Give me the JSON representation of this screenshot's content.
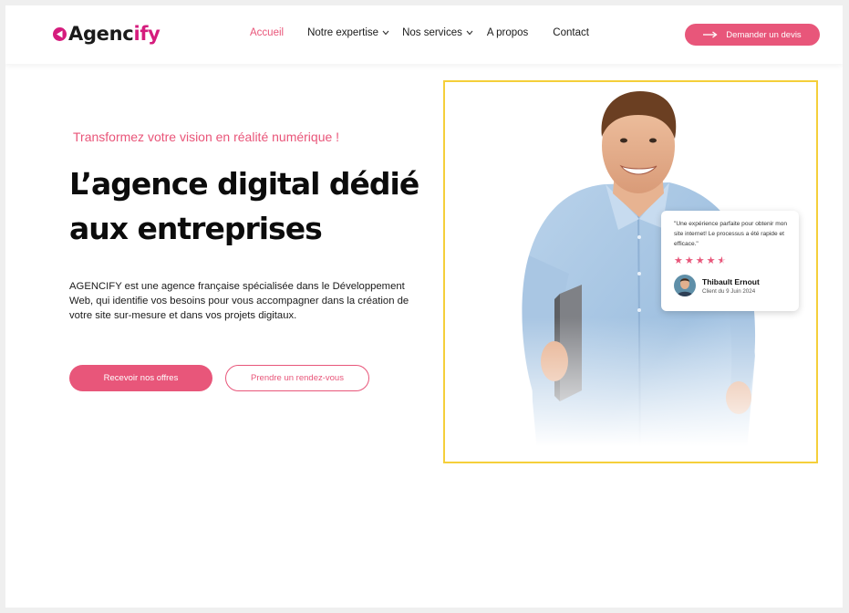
{
  "header": {
    "logo": {
      "prefix": "Ag",
      "mid": "ən",
      "main": "c",
      "accent": "ify",
      "full": "Agencify"
    },
    "nav": [
      {
        "label": "Accueil",
        "active": true,
        "has_dropdown": false
      },
      {
        "label": "Notre expertise",
        "active": false,
        "has_dropdown": true
      },
      {
        "label": "Nos services",
        "active": false,
        "has_dropdown": true
      },
      {
        "label": "A propos",
        "active": false,
        "has_dropdown": false
      },
      {
        "label": "Contact",
        "active": false,
        "has_dropdown": false
      }
    ],
    "cta_label": "Demander un devis"
  },
  "hero": {
    "tagline": "Transformez votre vision en réalité numérique !",
    "headline_line1": "L’agence digital dédié",
    "headline_line2": "aux entreprises",
    "description": "AGENCIFY est une agence française spécialisée dans le Développement Web, qui identifie vos besoins pour vous accompagner dans la création de votre site sur-mesure et dans vos projets digitaux.",
    "primary_button": "Recevoir nos offres",
    "secondary_button": "Prendre un rendez-vous"
  },
  "testimonial": {
    "quote": "\"Une expérience parfaite pour obtenir mon site internet! Le processus a été rapide et efficace.\"",
    "rating": 4.5,
    "rating_max": 5,
    "name": "Thibault Ernout",
    "date": "Client du 9 Juin 2024"
  },
  "colors": {
    "accent": "#e8567a",
    "brand_magenta": "#d51c7d",
    "frame_yellow": "#f5cf3a",
    "text_dark": "#0c0c0c"
  },
  "icons": {
    "logo": "play-circle-icon",
    "dropdown": "chevron-down-icon",
    "cta": "arrow-right-icon",
    "star": "star-icon"
  }
}
